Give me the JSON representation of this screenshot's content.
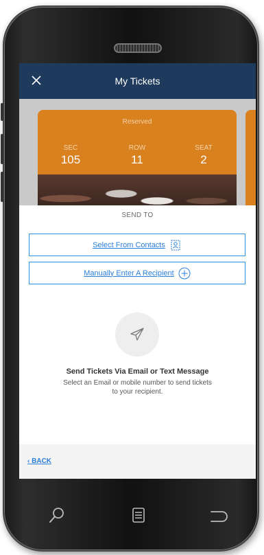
{
  "nav": {
    "title": "My Tickets"
  },
  "ticket": {
    "type_label": "Reserved",
    "columns": [
      {
        "label": "SEC",
        "value": "105"
      },
      {
        "label": "ROW",
        "value": "11"
      },
      {
        "label": "SEAT",
        "value": "2"
      }
    ]
  },
  "sheet": {
    "title": "SEND TO",
    "contacts_label": "Select From Contacts",
    "manual_label": "Manually Enter A Recipient",
    "heading": "Send Tickets Via Email or Text Message",
    "description": "Select an Email or mobile number to send tickets to your recipient.",
    "back_label": "BACK"
  },
  "colors": {
    "nav_bar": "#1e3a5c",
    "ticket_orange": "#d9801f",
    "link_blue": "#2a7ed8"
  },
  "icons": {
    "close": "close-icon",
    "contacts": "contacts-icon",
    "add": "plus-circle-icon",
    "send": "paper-plane-icon",
    "back": "chevron-left-icon",
    "search": "search-icon",
    "menu": "list-icon",
    "return": "return-icon"
  }
}
